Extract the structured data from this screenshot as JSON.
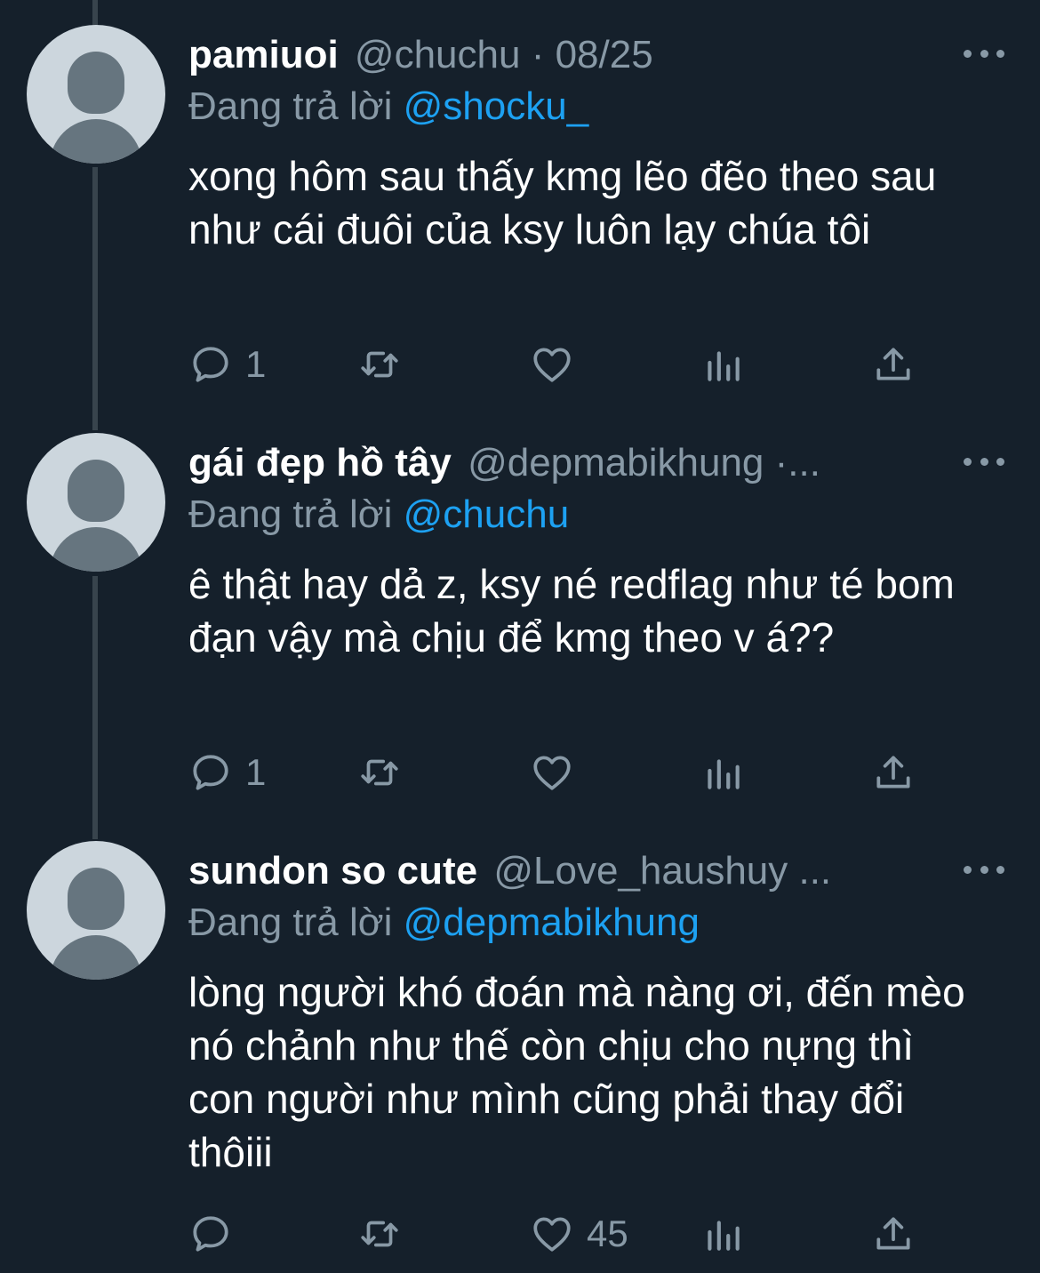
{
  "tweets": [
    {
      "name": "pamiuoi",
      "handle": "@chuchu · 08/25",
      "reply_prefix": "Đang trả lời",
      "reply_mention": "@shocku_",
      "text": "xong hôm sau thấy kmg lẽo đẽo theo sau như cái đuôi của ksy luôn lạy chúa tôi",
      "reply_count": "1",
      "like_count": ""
    },
    {
      "name": "gái đẹp hồ tây",
      "handle": "@depmabikhung ·...",
      "reply_prefix": "Đang trả lời",
      "reply_mention": "@chuchu",
      "text": "ê thật hay dả z, ksy né redflag như té bom đạn vậy mà chịu để kmg theo v á??",
      "reply_count": "1",
      "like_count": ""
    },
    {
      "name": "sundon so cute",
      "handle": "@Love_haushuy ...",
      "reply_prefix": "Đang trả lời",
      "reply_mention": "@depmabikhung",
      "text": "lòng người khó đoán mà nàng ơi, đến mèo nó chảnh như thế còn chịu cho nựng thì con người như mình cũng phải thay đổi thôiii",
      "reply_count": "",
      "like_count": "45"
    }
  ],
  "icons": {
    "reply": "reply-icon",
    "retweet": "retweet-icon",
    "like": "heart-icon",
    "stats": "analytics-icon",
    "share": "share-icon",
    "more": "more-icon"
  },
  "colors": {
    "background": "#15202b",
    "secondary_text": "#8899a6",
    "mention": "#1da1f2",
    "thread_line": "#38444d",
    "avatar_bg": "#ccd6dd",
    "avatar_fg": "#66757f"
  }
}
